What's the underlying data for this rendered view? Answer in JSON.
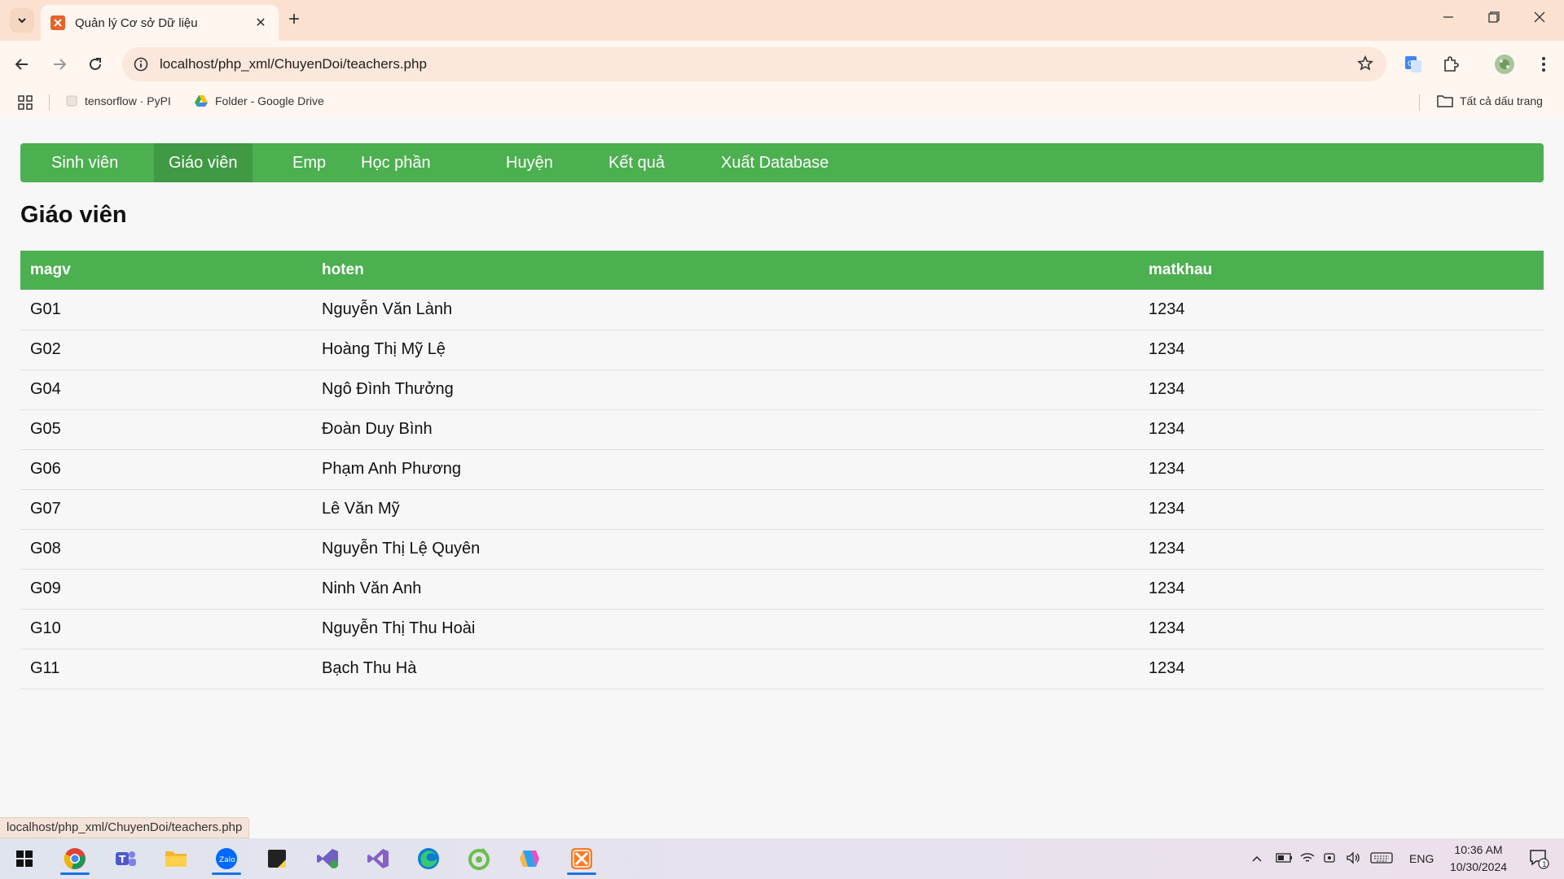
{
  "browser": {
    "tab_title": "Quản lý Cơ sở Dữ liệu",
    "tab_close": "✕",
    "new_tab": "+",
    "url": "localhost/php_xml/ChuyenDoi/teachers.php",
    "bookmarks": [
      {
        "label": "tensorflow · PyPI"
      },
      {
        "label": "Folder - Google Drive"
      }
    ],
    "all_bookmarks": "Tất cả dấu trang",
    "status_url": "localhost/php_xml/ChuyenDoi/teachers.php"
  },
  "nav": {
    "items": [
      {
        "label": "Sinh viên"
      },
      {
        "label": "Giáo viên",
        "active": true
      },
      {
        "label": "Emp"
      },
      {
        "label": "Học phần"
      },
      {
        "label": "Huyện"
      },
      {
        "label": "Kết quả"
      },
      {
        "label": "Xuất Database"
      }
    ]
  },
  "page": {
    "title": "Giáo viên"
  },
  "table": {
    "columns": [
      "magv",
      "hoten",
      "matkhau"
    ],
    "rows": [
      [
        "G01",
        "Nguyễn Văn Lành",
        "1234"
      ],
      [
        "G02",
        "Hoàng Thị Mỹ Lệ",
        "1234"
      ],
      [
        "G04",
        "Ngô Đình Thưởng",
        "1234"
      ],
      [
        "G05",
        "Đoàn Duy Bình",
        "1234"
      ],
      [
        "G06",
        "Phạm Anh Phương",
        "1234"
      ],
      [
        "G07",
        "Lê Văn Mỹ",
        "1234"
      ],
      [
        "G08",
        "Nguyễn Thị Lệ Quyên",
        "1234"
      ],
      [
        "G09",
        "Ninh Văn Anh",
        "1234"
      ],
      [
        "G10",
        "Nguyễn Thị Thu Hoài",
        "1234"
      ],
      [
        "G11",
        "Bạch Thu Hà",
        "1234"
      ]
    ]
  },
  "taskbar": {
    "language": "ENG",
    "time": "10:36 AM",
    "date": "10/30/2024",
    "notification_count": "1"
  },
  "colors": {
    "accent_green": "#4caf50",
    "active_green": "#3f9a43",
    "chrome_bg": "#fbe2d0"
  }
}
